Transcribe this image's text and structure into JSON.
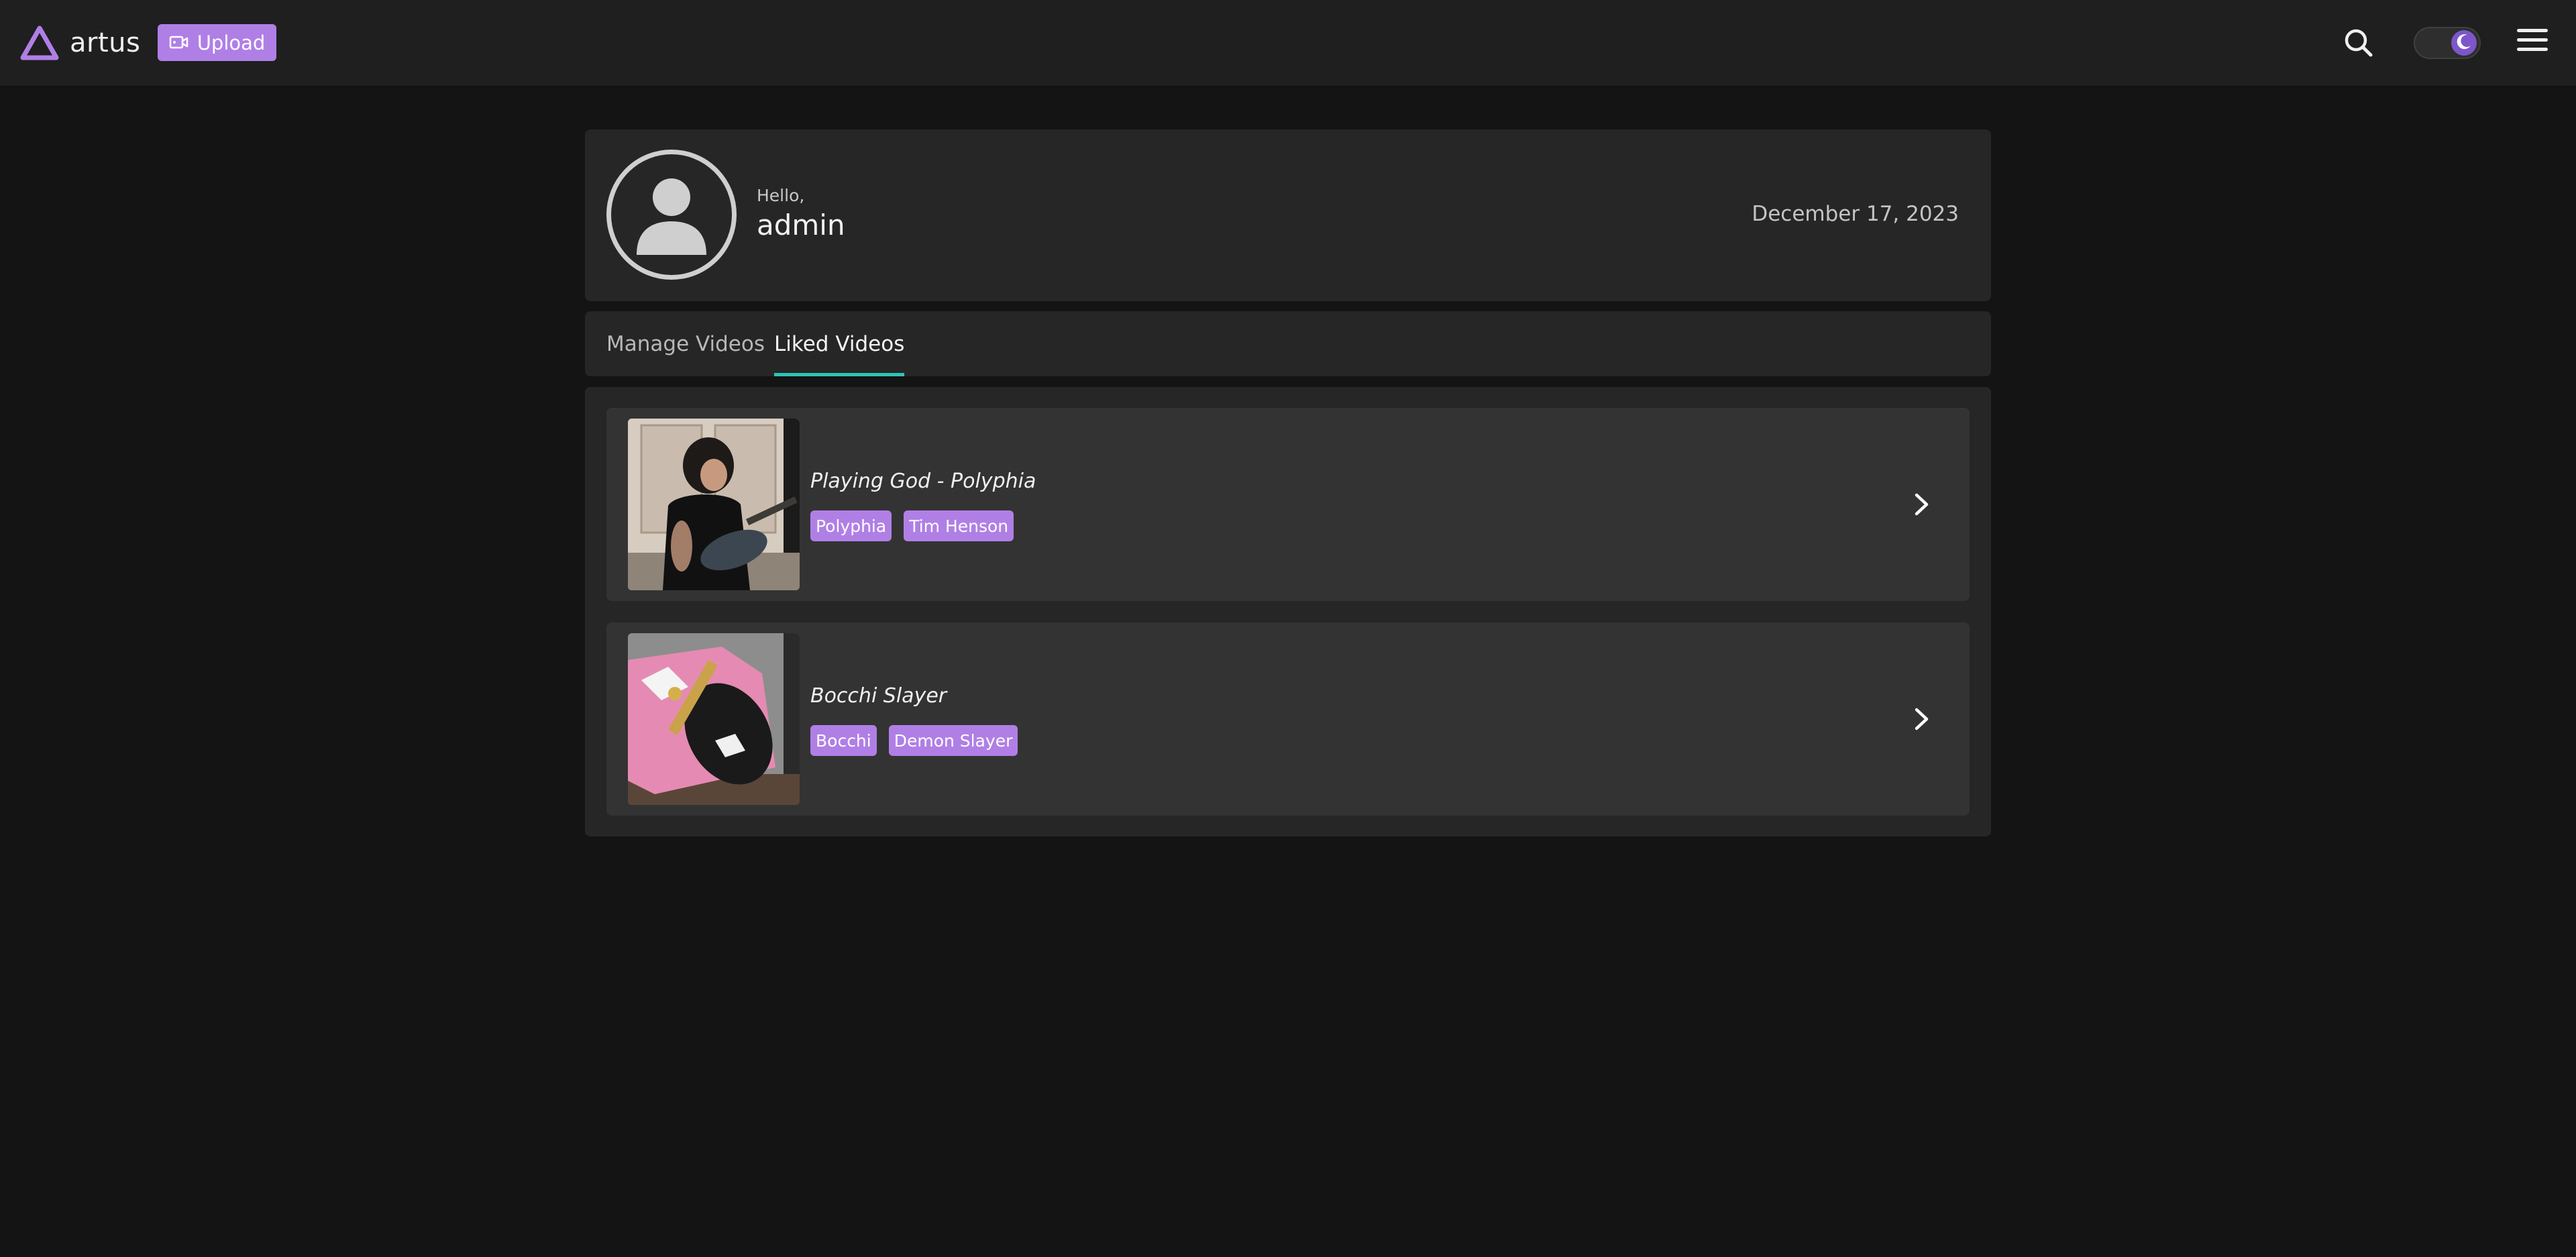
{
  "header": {
    "brand_name": "artus",
    "upload_label": "Upload"
  },
  "profile": {
    "greeting": "Hello,",
    "username": "admin",
    "date": "December 17, 2023"
  },
  "tabs": [
    {
      "label": "Manage Videos",
      "active": false
    },
    {
      "label": "Liked Videos",
      "active": true
    }
  ],
  "videos": [
    {
      "title": "Playing God - Polyphia",
      "tags": [
        "Polyphia",
        "Tim Henson"
      ]
    },
    {
      "title": "Bocchi Slayer",
      "tags": [
        "Bocchi",
        "Demon Slayer"
      ]
    }
  ],
  "colors": {
    "accent": "#b07fe6",
    "tab_underline": "#2ec4b6",
    "toggle_knob": "#7d56c9",
    "background": "#141414",
    "card": "#262626"
  },
  "icons": {
    "logo": "triangle-logo-icon",
    "upload": "video-camera-icon",
    "search": "search-icon",
    "theme": "moon-icon",
    "menu": "hamburger-menu-icon",
    "avatar": "user-avatar-icon",
    "chevron": "chevron-right-icon"
  }
}
